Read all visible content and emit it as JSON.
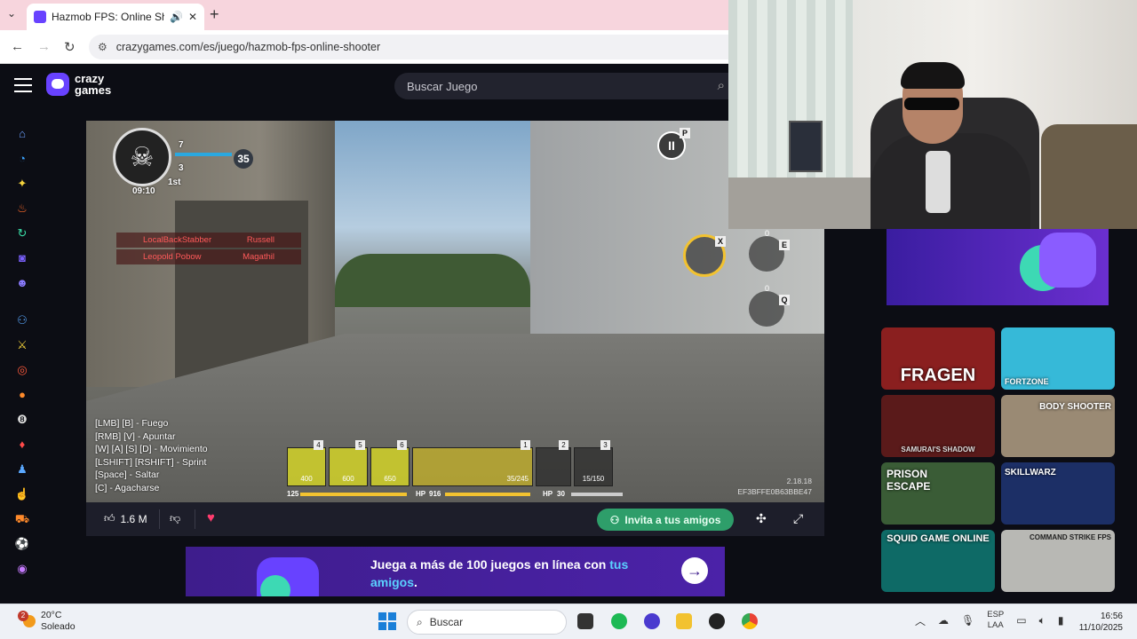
{
  "browser": {
    "tab_title": "Hazmob FPS: Online Shoote",
    "url": "crazygames.com/es/juego/hazmob-fps-online-shooter"
  },
  "site": {
    "logo_line1": "crazy",
    "logo_line2": "games",
    "search_placeholder": "Buscar Juego"
  },
  "game": {
    "hud": {
      "kills": "7",
      "deaths": "3",
      "score": "35",
      "timer": "09:10",
      "rank": "1st"
    },
    "killfeed": [
      {
        "killer": "LocalBackStabber",
        "victim": "Russell"
      },
      {
        "killer": "Leopold Pobow",
        "victim": "Magathil"
      }
    ],
    "keys": {
      "pause": "P",
      "ability": "X",
      "grenade": "E",
      "melee": "Q"
    },
    "grenade_counts": [
      "0",
      "0"
    ],
    "controls": [
      "[LMB] [B] - Fuego",
      "[RMB] [V] - Apuntar",
      "[W] [A] [S] [D] - Movimiento",
      "[LSHIFT] [RSHIFT] - Sprint",
      "[Space] - Saltar",
      "[C] - Agacharse"
    ],
    "weapon_slots": [
      {
        "num": "4",
        "count": "400"
      },
      {
        "num": "5",
        "count": "600"
      },
      {
        "num": "6",
        "count": "650"
      }
    ],
    "ammo": "35/245",
    "loadout_slots": [
      "1",
      "2",
      "3"
    ],
    "secondary_ammo": "15/150",
    "stats": {
      "armor": "125",
      "hp_label": "HP",
      "hp_value": "916",
      "hp2_label": "HP",
      "hp2_value": "30"
    },
    "version": "2.18.18",
    "build_id": "EF3BFFE0B63BBE47"
  },
  "footer": {
    "likes": "1.6 M",
    "invite_label": "Invita a tus amigos"
  },
  "banner": {
    "text_main": "Juega a más de 100 juegos en línea con",
    "text_highlight": "tus amigos",
    "text_end": "."
  },
  "thumbnails": [
    {
      "label": "FRAGEN",
      "bg": "#8a1f1f"
    },
    {
      "label": "FORTZONE",
      "bg": "#36b9d8"
    },
    {
      "label": "SAMURAI'S SHADOW",
      "bg": "#5a1a1a"
    },
    {
      "label": "BODY SHOOTER",
      "bg": "#9a8a74"
    },
    {
      "label": "PRISON ESCAPE",
      "bg": "#3a5c36"
    },
    {
      "label": "SKILLWARZ",
      "bg": "#1c2f66"
    },
    {
      "label": "SQUID GAME ONLINE",
      "bg": "#0e6a66"
    },
    {
      "label": "COMMAND STRIKE FPS",
      "bg": "#d4d4d0"
    }
  ],
  "taskbar": {
    "weather_temp": "20°C",
    "weather_desc": "Soleado",
    "weather_badge": "2",
    "search_label": "Buscar",
    "lang_line1": "ESP",
    "lang_line2": "LAA",
    "time": "16:56",
    "date": "11/10/2025"
  },
  "colors": {
    "brand": "#6842ff",
    "invite_green": "#2e9e6a",
    "hud_yellow": "#f2c230"
  }
}
